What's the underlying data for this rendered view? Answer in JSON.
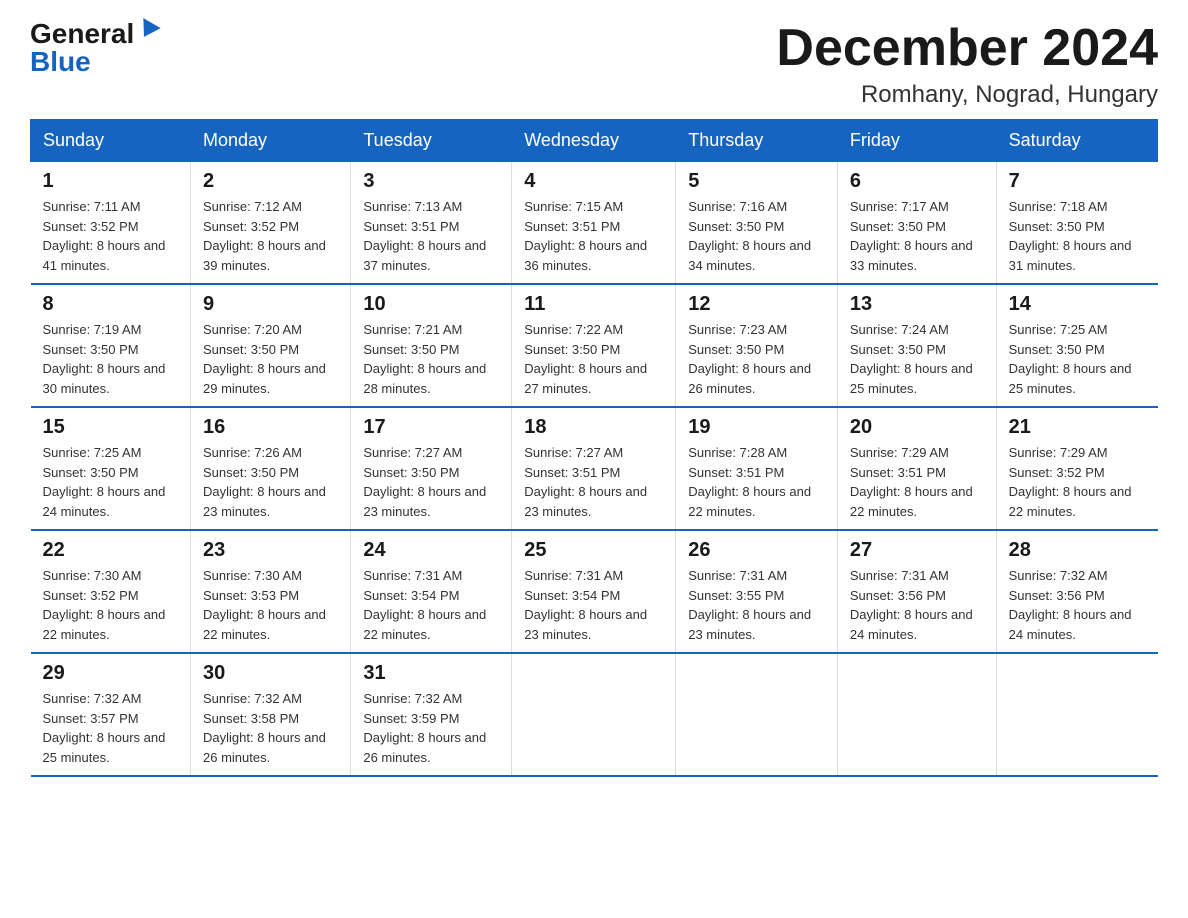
{
  "logo": {
    "general": "General",
    "blue": "Blue"
  },
  "title": {
    "month": "December 2024",
    "location": "Romhany, Nograd, Hungary"
  },
  "weekdays": [
    "Sunday",
    "Monday",
    "Tuesday",
    "Wednesday",
    "Thursday",
    "Friday",
    "Saturday"
  ],
  "weeks": [
    [
      {
        "day": "1",
        "sunrise": "7:11 AM",
        "sunset": "3:52 PM",
        "daylight": "8 hours and 41 minutes."
      },
      {
        "day": "2",
        "sunrise": "7:12 AM",
        "sunset": "3:52 PM",
        "daylight": "8 hours and 39 minutes."
      },
      {
        "day": "3",
        "sunrise": "7:13 AM",
        "sunset": "3:51 PM",
        "daylight": "8 hours and 37 minutes."
      },
      {
        "day": "4",
        "sunrise": "7:15 AM",
        "sunset": "3:51 PM",
        "daylight": "8 hours and 36 minutes."
      },
      {
        "day": "5",
        "sunrise": "7:16 AM",
        "sunset": "3:50 PM",
        "daylight": "8 hours and 34 minutes."
      },
      {
        "day": "6",
        "sunrise": "7:17 AM",
        "sunset": "3:50 PM",
        "daylight": "8 hours and 33 minutes."
      },
      {
        "day": "7",
        "sunrise": "7:18 AM",
        "sunset": "3:50 PM",
        "daylight": "8 hours and 31 minutes."
      }
    ],
    [
      {
        "day": "8",
        "sunrise": "7:19 AM",
        "sunset": "3:50 PM",
        "daylight": "8 hours and 30 minutes."
      },
      {
        "day": "9",
        "sunrise": "7:20 AM",
        "sunset": "3:50 PM",
        "daylight": "8 hours and 29 minutes."
      },
      {
        "day": "10",
        "sunrise": "7:21 AM",
        "sunset": "3:50 PM",
        "daylight": "8 hours and 28 minutes."
      },
      {
        "day": "11",
        "sunrise": "7:22 AM",
        "sunset": "3:50 PM",
        "daylight": "8 hours and 27 minutes."
      },
      {
        "day": "12",
        "sunrise": "7:23 AM",
        "sunset": "3:50 PM",
        "daylight": "8 hours and 26 minutes."
      },
      {
        "day": "13",
        "sunrise": "7:24 AM",
        "sunset": "3:50 PM",
        "daylight": "8 hours and 25 minutes."
      },
      {
        "day": "14",
        "sunrise": "7:25 AM",
        "sunset": "3:50 PM",
        "daylight": "8 hours and 25 minutes."
      }
    ],
    [
      {
        "day": "15",
        "sunrise": "7:25 AM",
        "sunset": "3:50 PM",
        "daylight": "8 hours and 24 minutes."
      },
      {
        "day": "16",
        "sunrise": "7:26 AM",
        "sunset": "3:50 PM",
        "daylight": "8 hours and 23 minutes."
      },
      {
        "day": "17",
        "sunrise": "7:27 AM",
        "sunset": "3:50 PM",
        "daylight": "8 hours and 23 minutes."
      },
      {
        "day": "18",
        "sunrise": "7:27 AM",
        "sunset": "3:51 PM",
        "daylight": "8 hours and 23 minutes."
      },
      {
        "day": "19",
        "sunrise": "7:28 AM",
        "sunset": "3:51 PM",
        "daylight": "8 hours and 22 minutes."
      },
      {
        "day": "20",
        "sunrise": "7:29 AM",
        "sunset": "3:51 PM",
        "daylight": "8 hours and 22 minutes."
      },
      {
        "day": "21",
        "sunrise": "7:29 AM",
        "sunset": "3:52 PM",
        "daylight": "8 hours and 22 minutes."
      }
    ],
    [
      {
        "day": "22",
        "sunrise": "7:30 AM",
        "sunset": "3:52 PM",
        "daylight": "8 hours and 22 minutes."
      },
      {
        "day": "23",
        "sunrise": "7:30 AM",
        "sunset": "3:53 PM",
        "daylight": "8 hours and 22 minutes."
      },
      {
        "day": "24",
        "sunrise": "7:31 AM",
        "sunset": "3:54 PM",
        "daylight": "8 hours and 22 minutes."
      },
      {
        "day": "25",
        "sunrise": "7:31 AM",
        "sunset": "3:54 PM",
        "daylight": "8 hours and 23 minutes."
      },
      {
        "day": "26",
        "sunrise": "7:31 AM",
        "sunset": "3:55 PM",
        "daylight": "8 hours and 23 minutes."
      },
      {
        "day": "27",
        "sunrise": "7:31 AM",
        "sunset": "3:56 PM",
        "daylight": "8 hours and 24 minutes."
      },
      {
        "day": "28",
        "sunrise": "7:32 AM",
        "sunset": "3:56 PM",
        "daylight": "8 hours and 24 minutes."
      }
    ],
    [
      {
        "day": "29",
        "sunrise": "7:32 AM",
        "sunset": "3:57 PM",
        "daylight": "8 hours and 25 minutes."
      },
      {
        "day": "30",
        "sunrise": "7:32 AM",
        "sunset": "3:58 PM",
        "daylight": "8 hours and 26 minutes."
      },
      {
        "day": "31",
        "sunrise": "7:32 AM",
        "sunset": "3:59 PM",
        "daylight": "8 hours and 26 minutes."
      },
      null,
      null,
      null,
      null
    ]
  ],
  "labels": {
    "sunrise_prefix": "Sunrise: ",
    "sunset_prefix": "Sunset: ",
    "daylight_prefix": "Daylight: "
  }
}
